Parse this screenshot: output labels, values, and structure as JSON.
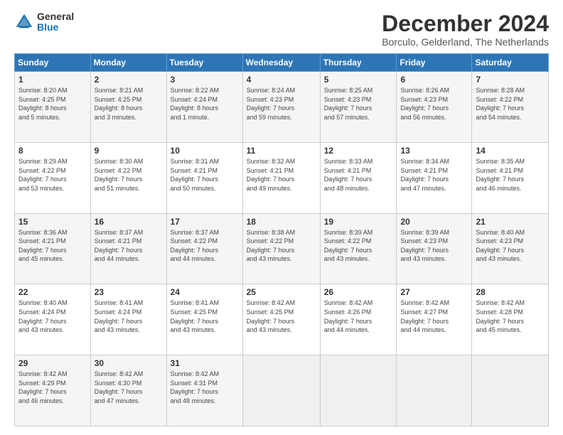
{
  "logo": {
    "line1": "General",
    "line2": "Blue"
  },
  "title": "December 2024",
  "subtitle": "Borculo, Gelderland, The Netherlands",
  "headers": [
    "Sunday",
    "Monday",
    "Tuesday",
    "Wednesday",
    "Thursday",
    "Friday",
    "Saturday"
  ],
  "weeks": [
    [
      {
        "day": "1",
        "info": "Sunrise: 8:20 AM\nSunset: 4:25 PM\nDaylight: 8 hours\nand 5 minutes."
      },
      {
        "day": "2",
        "info": "Sunrise: 8:21 AM\nSunset: 4:25 PM\nDaylight: 8 hours\nand 3 minutes."
      },
      {
        "day": "3",
        "info": "Sunrise: 8:22 AM\nSunset: 4:24 PM\nDaylight: 8 hours\nand 1 minute."
      },
      {
        "day": "4",
        "info": "Sunrise: 8:24 AM\nSunset: 4:23 PM\nDaylight: 7 hours\nand 59 minutes."
      },
      {
        "day": "5",
        "info": "Sunrise: 8:25 AM\nSunset: 4:23 PM\nDaylight: 7 hours\nand 57 minutes."
      },
      {
        "day": "6",
        "info": "Sunrise: 8:26 AM\nSunset: 4:23 PM\nDaylight: 7 hours\nand 56 minutes."
      },
      {
        "day": "7",
        "info": "Sunrise: 8:28 AM\nSunset: 4:22 PM\nDaylight: 7 hours\nand 54 minutes."
      }
    ],
    [
      {
        "day": "8",
        "info": "Sunrise: 8:29 AM\nSunset: 4:22 PM\nDaylight: 7 hours\nand 53 minutes."
      },
      {
        "day": "9",
        "info": "Sunrise: 8:30 AM\nSunset: 4:22 PM\nDaylight: 7 hours\nand 51 minutes."
      },
      {
        "day": "10",
        "info": "Sunrise: 8:31 AM\nSunset: 4:21 PM\nDaylight: 7 hours\nand 50 minutes."
      },
      {
        "day": "11",
        "info": "Sunrise: 8:32 AM\nSunset: 4:21 PM\nDaylight: 7 hours\nand 49 minutes."
      },
      {
        "day": "12",
        "info": "Sunrise: 8:33 AM\nSunset: 4:21 PM\nDaylight: 7 hours\nand 48 minutes."
      },
      {
        "day": "13",
        "info": "Sunrise: 8:34 AM\nSunset: 4:21 PM\nDaylight: 7 hours\nand 47 minutes."
      },
      {
        "day": "14",
        "info": "Sunrise: 8:35 AM\nSunset: 4:21 PM\nDaylight: 7 hours\nand 46 minutes."
      }
    ],
    [
      {
        "day": "15",
        "info": "Sunrise: 8:36 AM\nSunset: 4:21 PM\nDaylight: 7 hours\nand 45 minutes."
      },
      {
        "day": "16",
        "info": "Sunrise: 8:37 AM\nSunset: 4:21 PM\nDaylight: 7 hours\nand 44 minutes."
      },
      {
        "day": "17",
        "info": "Sunrise: 8:37 AM\nSunset: 4:22 PM\nDaylight: 7 hours\nand 44 minutes."
      },
      {
        "day": "18",
        "info": "Sunrise: 8:38 AM\nSunset: 4:22 PM\nDaylight: 7 hours\nand 43 minutes."
      },
      {
        "day": "19",
        "info": "Sunrise: 8:39 AM\nSunset: 4:22 PM\nDaylight: 7 hours\nand 43 minutes."
      },
      {
        "day": "20",
        "info": "Sunrise: 8:39 AM\nSunset: 4:23 PM\nDaylight: 7 hours\nand 43 minutes."
      },
      {
        "day": "21",
        "info": "Sunrise: 8:40 AM\nSunset: 4:23 PM\nDaylight: 7 hours\nand 43 minutes."
      }
    ],
    [
      {
        "day": "22",
        "info": "Sunrise: 8:40 AM\nSunset: 4:24 PM\nDaylight: 7 hours\nand 43 minutes."
      },
      {
        "day": "23",
        "info": "Sunrise: 8:41 AM\nSunset: 4:24 PM\nDaylight: 7 hours\nand 43 minutes."
      },
      {
        "day": "24",
        "info": "Sunrise: 8:41 AM\nSunset: 4:25 PM\nDaylight: 7 hours\nand 43 minutes."
      },
      {
        "day": "25",
        "info": "Sunrise: 8:42 AM\nSunset: 4:25 PM\nDaylight: 7 hours\nand 43 minutes."
      },
      {
        "day": "26",
        "info": "Sunrise: 8:42 AM\nSunset: 4:26 PM\nDaylight: 7 hours\nand 44 minutes."
      },
      {
        "day": "27",
        "info": "Sunrise: 8:42 AM\nSunset: 4:27 PM\nDaylight: 7 hours\nand 44 minutes."
      },
      {
        "day": "28",
        "info": "Sunrise: 8:42 AM\nSunset: 4:28 PM\nDaylight: 7 hours\nand 45 minutes."
      }
    ],
    [
      {
        "day": "29",
        "info": "Sunrise: 8:42 AM\nSunset: 4:29 PM\nDaylight: 7 hours\nand 46 minutes."
      },
      {
        "day": "30",
        "info": "Sunrise: 8:42 AM\nSunset: 4:30 PM\nDaylight: 7 hours\nand 47 minutes."
      },
      {
        "day": "31",
        "info": "Sunrise: 8:42 AM\nSunset: 4:31 PM\nDaylight: 7 hours\nand 48 minutes."
      },
      {
        "day": "",
        "info": ""
      },
      {
        "day": "",
        "info": ""
      },
      {
        "day": "",
        "info": ""
      },
      {
        "day": "",
        "info": ""
      }
    ]
  ]
}
